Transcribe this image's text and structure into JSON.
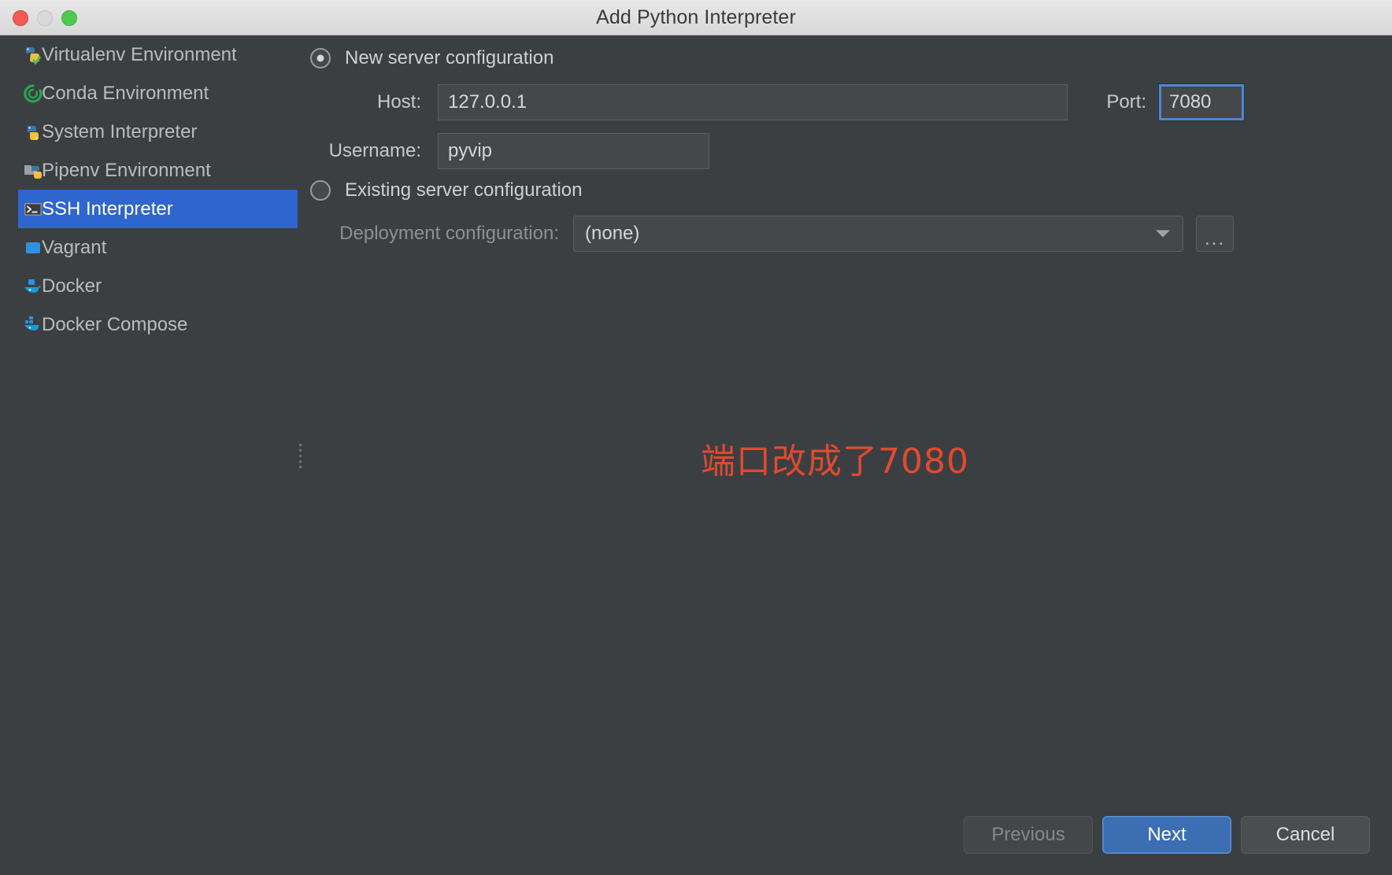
{
  "window": {
    "title": "Add Python Interpreter",
    "traffic_lights": [
      "close",
      "minimize",
      "zoom"
    ]
  },
  "sidebar": {
    "items": [
      {
        "label": "Virtualenv Environment",
        "icon": "python-virtualenv-icon",
        "selected": false
      },
      {
        "label": "Conda Environment",
        "icon": "conda-icon",
        "selected": false
      },
      {
        "label": "System Interpreter",
        "icon": "python-icon",
        "selected": false
      },
      {
        "label": "Pipenv Environment",
        "icon": "pipenv-icon",
        "selected": false
      },
      {
        "label": "SSH Interpreter",
        "icon": "terminal-icon",
        "selected": true
      },
      {
        "label": "Vagrant",
        "icon": "vagrant-icon",
        "selected": false
      },
      {
        "label": "Docker",
        "icon": "docker-icon",
        "selected": false
      },
      {
        "label": "Docker Compose",
        "icon": "docker-compose-icon",
        "selected": false
      }
    ],
    "selected_index": 4
  },
  "main": {
    "new_server": {
      "radio_label": "New server configuration",
      "checked": true,
      "host_label": "Host:",
      "host_value": "127.0.0.1",
      "port_label": "Port:",
      "port_value": "7080",
      "username_label": "Username:",
      "username_value": "pyvip"
    },
    "existing_server": {
      "radio_label": "Existing server configuration",
      "checked": false,
      "deployment_label": "Deployment configuration:",
      "deployment_value": "(none)",
      "browse_label": "..."
    }
  },
  "annotation": {
    "text": "端口改成了7080",
    "color": "#e04a2f"
  },
  "footer": {
    "previous_label": "Previous",
    "next_label": "Next",
    "cancel_label": "Cancel"
  },
  "colors": {
    "window_bg": "#3c3f41",
    "titlebar_bg": "#e0e0e0",
    "selection_blue": "#2f65ce",
    "focus_blue": "#4a88d6",
    "default_button_blue": "#3c6eb4"
  }
}
